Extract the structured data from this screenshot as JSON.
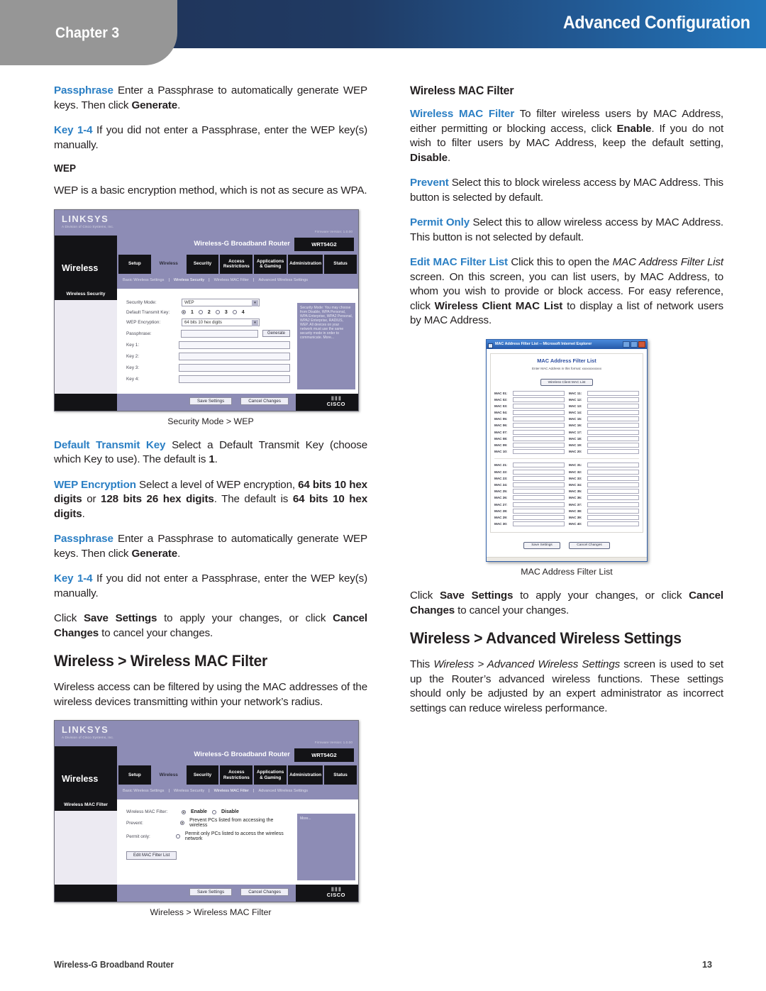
{
  "header": {
    "chapter_label": "Chapter 3",
    "title": "Advanced Configuration",
    "colors": {
      "tab_gray": "#969696",
      "gradient_start": "#20365c",
      "gradient_end": "#2376bb"
    }
  },
  "colors": {
    "accent_blue": "#2b7fc4",
    "text": "#231f20"
  },
  "left_column": {
    "p_passphrase_1": {
      "lbl": "Passphrase",
      "text": " Enter a Passphrase to automatically generate WEP keys. Then click ",
      "bold": "Generate",
      "tail": "."
    },
    "p_key_1": {
      "lbl": "Key 1-4",
      "text": " If you did not enter a Passphrase, enter the WEP key(s) manually."
    },
    "wep_heading": "WEP",
    "p_wep_desc": "WEP is a basic encryption method, which is not as secure as WPA.",
    "caption_wep": "Security Mode > WEP",
    "p_default_transmit_key": {
      "lbl": "Default Transmit Key",
      "text": " Select a Default Transmit Key (choose which Key to use). The default is ",
      "bold": "1",
      "tail": "."
    },
    "p_wep_encryption": {
      "lbl": "WEP Encryption",
      "text": " Select a level of WEP encryption, ",
      "bold1": "64 bits 10 hex digits",
      "mid": " or ",
      "bold2": "128 bits 26 hex digits",
      "mid2": ". The default is ",
      "bold3": "64 bits 10 hex digits",
      "tail": "."
    },
    "p_passphrase_2": {
      "lbl": "Passphrase",
      "text": " Enter a Passphrase to automatically generate WEP keys. Then click ",
      "bold": "Generate",
      "tail": "."
    },
    "p_key_2": {
      "lbl": "Key 1-4",
      "text": " If you did not enter a Passphrase, enter the WEP key(s) manually."
    },
    "p_save": {
      "pre": "Click ",
      "bold1": "Save Settings",
      "mid": " to apply your changes, or click ",
      "bold2": "Cancel Changes",
      "tail": " to cancel your changes."
    },
    "section_heading": "Wireless > Wireless MAC Filter",
    "p_mac_intro": "Wireless access can be filtered by using the MAC addresses of the wireless devices transmitting within your network’s radius.",
    "caption_mac_filter": "Wireless > Wireless MAC Filter"
  },
  "right_column": {
    "sub_heading": "Wireless MAC Filter",
    "p_wireless_mac_filter": {
      "lbl": "Wireless MAC Filter",
      "text": " To filter wireless users by MAC Address, either permitting or blocking access, click ",
      "bold1": "Enable",
      "mid": ". If you do not wish to filter users by MAC Address, keep the default setting, ",
      "bold2": "Disable",
      "tail": "."
    },
    "p_prevent": {
      "lbl": "Prevent",
      "text": " Select this to block wireless access by MAC Address. This button is selected by default."
    },
    "p_permit_only": {
      "lbl": "Permit Only",
      "text": " Select this to allow wireless access by MAC Address. This button is not selected by default."
    },
    "p_edit_mac_filter_list": {
      "lbl": "Edit MAC Filter List",
      "text": " Click this to open the ",
      "ital": "MAC Address Filter List",
      "mid": " screen. On this screen, you can list users, by MAC Address, to whom you wish to provide or block access. For easy reference, click ",
      "bold": "Wireless Client MAC List",
      "tail": " to display a list of network users by MAC Address."
    },
    "caption_mac_address_filter_list": "MAC Address Filter List",
    "p_save": {
      "pre": "Click ",
      "bold1": "Save Settings",
      "mid": " to apply your changes, or click ",
      "bold2": "Cancel Changes",
      "tail": " to cancel your changes."
    },
    "section_heading": "Wireless > Advanced Wireless Settings",
    "p_advanced_intro": {
      "pre": "This ",
      "ital": "Wireless > Advanced Wireless Settings",
      "text": " screen is used to set up the Router’s advanced wireless functions. These settings should only be adjusted by an expert administrator as incorrect settings can reduce wireless performance."
    }
  },
  "screenshot_wep": {
    "brand": "LINKSYS",
    "brand_sub": "A Division of Cisco Systems, Inc.",
    "firmware": "Firmware Version: 1.0.00",
    "product": "Wireless-G Broadband Router",
    "model": "WRT54G2",
    "section_word": "Wireless",
    "tabs": [
      "Setup",
      "Wireless",
      "Security",
      "Access Restrictions",
      "Applications & Gaming",
      "Administration",
      "Status"
    ],
    "active_tab": "Wireless",
    "subtabs": [
      "Basic Wireless Settings",
      "Wireless Security",
      "Wireless MAC Filter",
      "Advanced Wireless Settings"
    ],
    "active_subtab": "Wireless Security",
    "panel_label": "Wireless Security",
    "fields": [
      {
        "name": "Security Mode:",
        "type": "select",
        "value": "WEP"
      },
      {
        "name": "Default Transmit Key:",
        "type": "radios",
        "options": [
          "1",
          "2",
          "3",
          "4"
        ],
        "selected": "1"
      },
      {
        "name": "WEP Encryption:",
        "type": "select",
        "value": "64 bits 10 hex digits"
      },
      {
        "name": "Passphrase:",
        "type": "input-button",
        "value": "",
        "button": "Generate"
      },
      {
        "name": "Key 1:",
        "type": "input",
        "value": ""
      },
      {
        "name": "Key 2:",
        "type": "input",
        "value": ""
      },
      {
        "name": "Key 3:",
        "type": "input",
        "value": ""
      },
      {
        "name": "Key 4:",
        "type": "input",
        "value": ""
      }
    ],
    "help_text": "Security Mode: You may choose from Disable, WPA Personal, WPA Enterprise, WPA2 Personal, WPA2 Enterprise, RADIUS, WEP. All devices on your network must use the same security mode in order to communicate. More...",
    "buttons": [
      "Save Settings",
      "Cancel Changes"
    ],
    "cisco_logo": "CISCO"
  },
  "screenshot_mac_filter": {
    "brand": "LINKSYS",
    "brand_sub": "A Division of Cisco Systems, Inc.",
    "firmware": "Firmware Version: 1.0.00",
    "product": "Wireless-G Broadband Router",
    "model": "WRT54G2",
    "section_word": "Wireless",
    "tabs": [
      "Setup",
      "Wireless",
      "Security",
      "Access Restrictions",
      "Applications & Gaming",
      "Administration",
      "Status"
    ],
    "active_tab": "Wireless",
    "subtabs": [
      "Basic Wireless Settings",
      "Wireless Security",
      "Wireless MAC Filter",
      "Advanced Wireless Settings"
    ],
    "active_subtab": "Wireless MAC Filter",
    "panel_label": "Wireless MAC Filter",
    "fields": [
      {
        "name": "Wireless MAC Filter:",
        "type": "radios2",
        "options": [
          "Enable",
          "Disable"
        ],
        "selected": "Enable"
      },
      {
        "name": "Prevent:",
        "type": "radio-line",
        "text": "Prevent PCs listed from accessing the wireless",
        "selected": true
      },
      {
        "name": "Permit only:",
        "type": "radio-line",
        "text": "Permit only PCs listed to access the wireless network",
        "selected": false
      }
    ],
    "edit_button": "Edit MAC Filter List",
    "help_text": "More...",
    "buttons": [
      "Save Settings",
      "Cancel Changes"
    ],
    "cisco_logo": "CISCO"
  },
  "dialog_mac_list": {
    "window_title": "MAC Address Filter List -- Microsoft Internet Explorer",
    "heading": "MAC Address Filter List",
    "note": "Enter MAC Address in this format: xxxxxxxxxxxx",
    "client_list_button": "Wireless Client MAC List",
    "block1_left": [
      "MAC 01:",
      "MAC 02:",
      "MAC 03:",
      "MAC 04:",
      "MAC 05:",
      "MAC 06:",
      "MAC 07:",
      "MAC 08:",
      "MAC 09:",
      "MAC 10:"
    ],
    "block1_right": [
      "MAC 11:",
      "MAC 12:",
      "MAC 13:",
      "MAC 14:",
      "MAC 15:",
      "MAC 16:",
      "MAC 17:",
      "MAC 18:",
      "MAC 19:",
      "MAC 20:"
    ],
    "block2_left": [
      "MAC 21:",
      "MAC 22:",
      "MAC 23:",
      "MAC 24:",
      "MAC 25:",
      "MAC 26:",
      "MAC 27:",
      "MAC 28:",
      "MAC 29:",
      "MAC 30:"
    ],
    "block2_right": [
      "MAC 31:",
      "MAC 32:",
      "MAC 33:",
      "MAC 34:",
      "MAC 35:",
      "MAC 36:",
      "MAC 37:",
      "MAC 38:",
      "MAC 39:",
      "MAC 40:"
    ],
    "buttons": [
      "Save Settings",
      "Cancel Changes"
    ]
  },
  "footer": {
    "left": "Wireless-G Broadband Router",
    "page_number": "13"
  }
}
